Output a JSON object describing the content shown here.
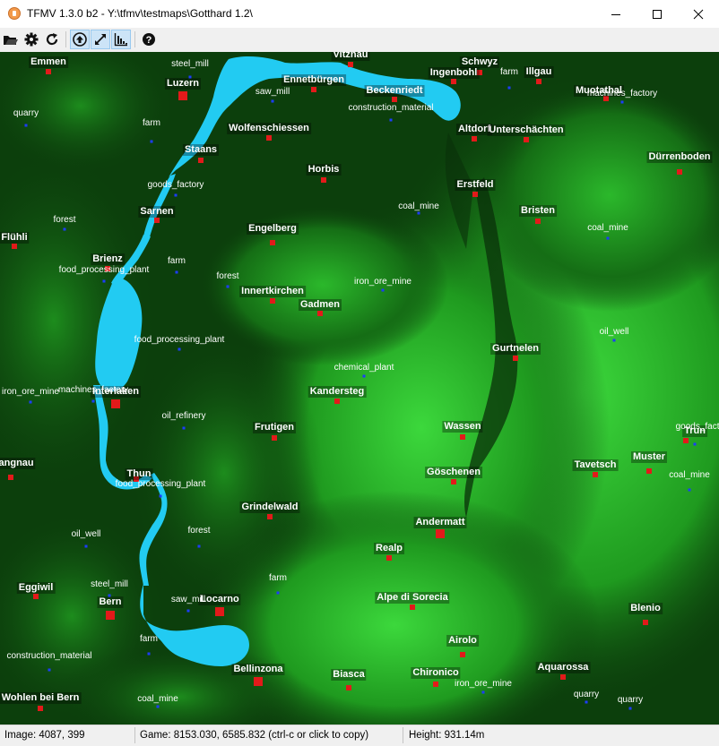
{
  "window": {
    "title": "TFMV 1.3.0 b2 - Y:\\tfmv\\testmaps\\Gotthard 1.2\\"
  },
  "toolbar": {
    "items": [
      "open-folder-icon",
      "settings-gear-icon",
      "refresh-icon",
      "up-arrow-icon",
      "expand-icon",
      "histogram-icon",
      "help-icon"
    ],
    "pressed": [
      "up-arrow-icon",
      "expand-icon",
      "histogram-icon"
    ]
  },
  "map": {
    "colors": {
      "water": "#22cbf2",
      "town": "#e21a1a",
      "industry": "#1d3cff"
    },
    "towns": [
      {
        "name": "Emmen",
        "size": "small"
      },
      {
        "name": "Luzern",
        "size": "big"
      },
      {
        "name": "Vitznau",
        "size": "small"
      },
      {
        "name": "Schwyz",
        "size": "small"
      },
      {
        "name": "Ingenbohl",
        "size": "small"
      },
      {
        "name": "Illgau",
        "size": "small"
      },
      {
        "name": "Ennetbürgen",
        "size": "small"
      },
      {
        "name": "Beckenriedt",
        "size": "small"
      },
      {
        "name": "Muotathal",
        "size": "small"
      },
      {
        "name": "Wolfenschiessen",
        "size": "small"
      },
      {
        "name": "Altdorf",
        "size": "small"
      },
      {
        "name": "Unterschächten",
        "size": "small"
      },
      {
        "name": "Staans",
        "size": "small"
      },
      {
        "name": "Dürrenboden",
        "size": "small"
      },
      {
        "name": "Horbis",
        "size": "small"
      },
      {
        "name": "Erstfeld",
        "size": "small"
      },
      {
        "name": "Sarnen",
        "size": "small"
      },
      {
        "name": "Bristen",
        "size": "small"
      },
      {
        "name": "Engelberg",
        "size": "small"
      },
      {
        "name": "Flühli",
        "size": "small"
      },
      {
        "name": "Brienz",
        "size": "small"
      },
      {
        "name": "Innertkirchen",
        "size": "small"
      },
      {
        "name": "Gadmen",
        "size": "small"
      },
      {
        "name": "Gurtnelen",
        "size": "small"
      },
      {
        "name": "Interlaken",
        "size": "big"
      },
      {
        "name": "Kandersteg",
        "size": "small"
      },
      {
        "name": "Frutigen",
        "size": "small"
      },
      {
        "name": "Wassen",
        "size": "small"
      },
      {
        "name": "Trun",
        "size": "small"
      },
      {
        "name": "Schangnau",
        "size": "small"
      },
      {
        "name": "Thun",
        "size": "small"
      },
      {
        "name": "Göschenen",
        "size": "small"
      },
      {
        "name": "Tavetsch",
        "size": "small"
      },
      {
        "name": "Muster",
        "size": "small"
      },
      {
        "name": "Grindelwald",
        "size": "small"
      },
      {
        "name": "Andermatt",
        "size": "big"
      },
      {
        "name": "Realp",
        "size": "small"
      },
      {
        "name": "Eggiwil",
        "size": "small"
      },
      {
        "name": "Bern",
        "size": "big"
      },
      {
        "name": "Locarno",
        "size": "big"
      },
      {
        "name": "Alpe di Sorecia",
        "size": "small"
      },
      {
        "name": "Blenio",
        "size": "small"
      },
      {
        "name": "Airolo",
        "size": "small"
      },
      {
        "name": "Bellinzona",
        "size": "big"
      },
      {
        "name": "Biasca",
        "size": "small"
      },
      {
        "name": "Chironico",
        "size": "small"
      },
      {
        "name": "Aquarossa",
        "size": "small"
      },
      {
        "name": "Wohlen bei Bern",
        "size": "small"
      }
    ],
    "industries": [
      "steel_mill",
      "saw_mill",
      "farm",
      "quarry",
      "farm",
      "construction_material",
      "machines_factory",
      "goods_factory",
      "coal_mine",
      "forest",
      "coal_mine",
      "farm",
      "food_processing_plant",
      "forest",
      "iron_ore_mine",
      "food_processing_plant",
      "oil_well",
      "chemical_plant",
      "iron_ore_mine",
      "machines_factory",
      "oil_refinery",
      "goods_factory",
      "food_processing_plant",
      "coal_mine",
      "oil_well",
      "forest",
      "steel_mill",
      "saw_mill",
      "farm",
      "farm",
      "construction_material",
      "coal_mine",
      "iron_ore_mine",
      "quarry",
      "quarry"
    ]
  },
  "status": {
    "image": "Image: 4087, 399",
    "game": "Game: 8153.030, 6585.832 (ctrl-c or click to copy)",
    "height": "Height: 931.14m"
  }
}
